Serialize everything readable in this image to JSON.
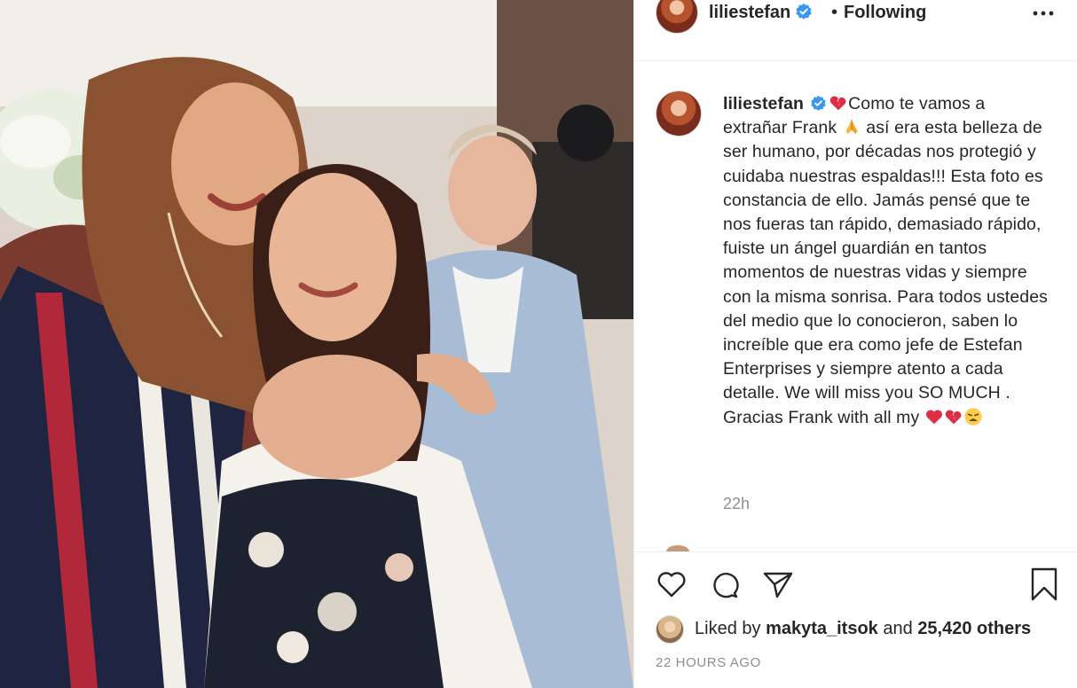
{
  "post": {
    "username": "liliestefan",
    "follow_status": "Following",
    "dot": "•",
    "caption_parts": {
      "p1": "Como te vamos a extrañar Frank",
      "p2": "así era esta belleza de ser humano, por décadas nos protegió y cuidaba nuestras espaldas!!! Esta foto es constancia de ello. Jamás pensé que te nos fueras tan rápido, demasiado rápido, fuiste un ángel guardián en tantos momentos de nuestras vidas y siempre con la misma sonrisa. Para todos ustedes del medio que lo conocieron, saben lo increíble que era como jefe de Estefan Enterprises y siempre atento a cada detalle. We will miss you SO MUCH . Gracias Frank with all my"
    },
    "time_relative": "22h",
    "likes": {
      "prefix": "Liked by",
      "liker": "makyta_itsok",
      "joiner": "and",
      "others": "25,420 others"
    },
    "timestamp": "22 HOURS AGO"
  },
  "icons": {
    "verified": "verified-badge-icon",
    "more": "more-options-icon",
    "like": "heart-icon",
    "comment": "comment-bubble-icon",
    "share": "paper-plane-icon",
    "save": "bookmark-icon",
    "broken_heart": "broken-heart-emoji",
    "praying_hands": "praying-hands-emoji",
    "red_heart": "red-heart-emoji",
    "weary_face": "weary-face-emoji"
  },
  "colors": {
    "verified_blue": "#3897f0",
    "text_primary": "#262626",
    "text_secondary": "#8e8e8e",
    "divider": "#efefef",
    "emoji_red": "#dd2e44"
  }
}
